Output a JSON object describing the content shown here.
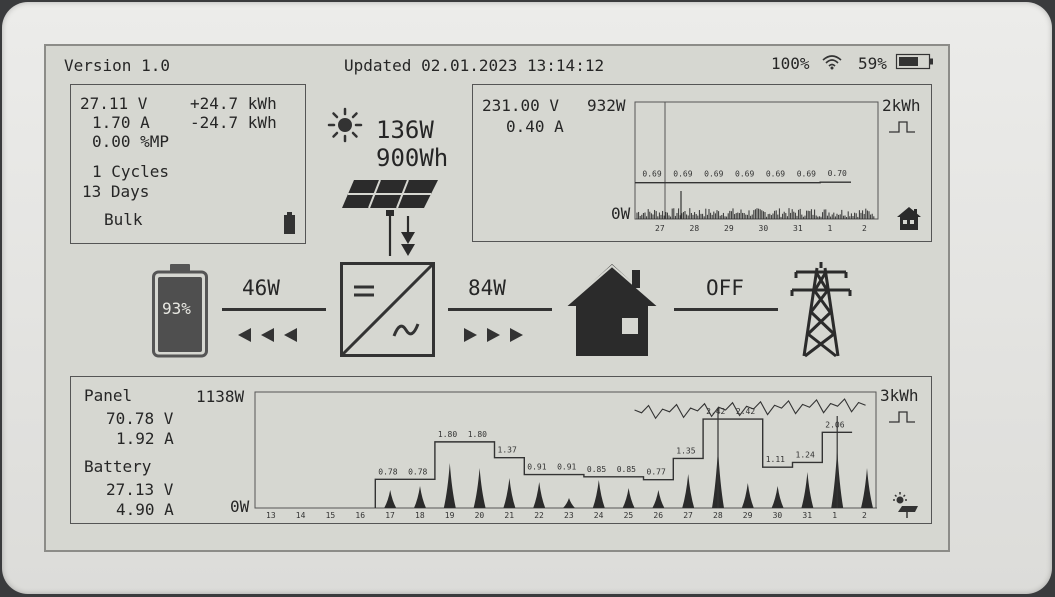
{
  "status": {
    "version": "Version 1.0",
    "updated": "Updated 02.01.2023 13:14:12",
    "signal": "100%",
    "battery": "59%"
  },
  "battery_panel": {
    "voltage": "27.11 V",
    "current": "1.70 A",
    "mpp": "0.00 %MP",
    "energy_in": "+24.7 kWh",
    "energy_out": "-24.7 kWh",
    "cycles": "1 Cycles",
    "days": "13 Days",
    "mode": "Bulk"
  },
  "solar": {
    "power": "136W",
    "energy": "900Wh"
  },
  "grid_panel": {
    "voltage": "231.00 V",
    "current": "0.40 A",
    "power": "932W",
    "scale": "2kWh",
    "zero": "0W",
    "bar_labels": [
      "0.69",
      "0.69",
      "0.69",
      "0.69",
      "0.69",
      "0.69",
      "0.70"
    ],
    "x_ticks": [
      "27",
      "28",
      "29",
      "30",
      "31",
      "1",
      "2"
    ]
  },
  "flow": {
    "battery_level": "93%",
    "battery_power": "46W",
    "inverter_power": "84W",
    "grid_state": "OFF"
  },
  "history": {
    "panel_label": "Panel",
    "panel_voltage": "70.78 V",
    "panel_current": "1.92 A",
    "battery_label": "Battery",
    "battery_voltage": "27.13 V",
    "battery_current": "4.90 A",
    "max": "1138W",
    "zero": "0W",
    "scale": "3kWh",
    "x_ticks": [
      "13",
      "14",
      "15",
      "16",
      "17",
      "18",
      "19",
      "20",
      "21",
      "22",
      "23",
      "24",
      "25",
      "26",
      "27",
      "28",
      "29",
      "30",
      "31",
      "1",
      "2"
    ]
  },
  "chart_data": [
    {
      "type": "bar",
      "title": "",
      "categories": [
        "27",
        "28",
        "29",
        "30",
        "31",
        "1",
        "2"
      ],
      "values": [
        0.69,
        0.69,
        0.69,
        0.69,
        0.69,
        0.69,
        0.7
      ],
      "ylabel": "kWh"
    },
    {
      "type": "bar",
      "title": "",
      "categories": [
        "17",
        "18",
        "19",
        "20",
        "21",
        "22",
        "23",
        "24",
        "25",
        "26",
        "27",
        "28",
        "29",
        "30",
        "31",
        "1",
        "2"
      ],
      "values": [
        0.78,
        0.78,
        1.8,
        1.8,
        1.37,
        0.91,
        0.91,
        0.85,
        0.85,
        0.77,
        1.35,
        2.42,
        2.42,
        1.11,
        1.24,
        2.06,
        null
      ],
      "labels": [
        "0.78",
        "0.78",
        "1.80",
        "1.80",
        "1.37",
        "0.91",
        "0.91",
        "0.85",
        "0.85",
        "0.77",
        "1.35",
        "2.42",
        "2.42",
        "1.11",
        "1.24",
        "2.06"
      ],
      "ylabel": "kWh"
    }
  ],
  "colors": {
    "ink": "#262626",
    "screen": "#d6d7d1",
    "bezel": "#e4e4e1"
  }
}
